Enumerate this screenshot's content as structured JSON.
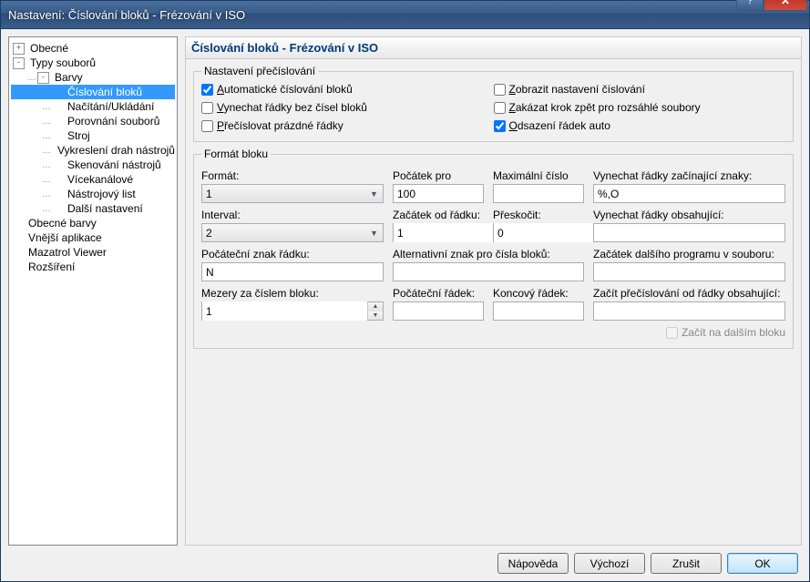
{
  "window": {
    "title": "Nastavení: Číslování bloků - Frézování v ISO"
  },
  "tree": {
    "items": [
      {
        "lvl": 0,
        "exp": "+",
        "label": "Obecné"
      },
      {
        "lvl": 0,
        "exp": "-",
        "label": "Typy souborů"
      },
      {
        "lvl": 1,
        "exp": "-",
        "label": "Barvy"
      },
      {
        "lvl": 2,
        "exp": "",
        "label": "Číslování bloků",
        "sel": true
      },
      {
        "lvl": 2,
        "exp": "",
        "label": "Načítání/Ukládání"
      },
      {
        "lvl": 2,
        "exp": "",
        "label": "Porovnání souborů"
      },
      {
        "lvl": 2,
        "exp": "",
        "label": "Stroj"
      },
      {
        "lvl": 2,
        "exp": "",
        "label": "Vykreslení drah nástrojů"
      },
      {
        "lvl": 2,
        "exp": "",
        "label": "Skenování nástrojů"
      },
      {
        "lvl": 2,
        "exp": "",
        "label": "Vícekanálové"
      },
      {
        "lvl": 2,
        "exp": "",
        "label": "Nástrojový list"
      },
      {
        "lvl": 2,
        "exp": "",
        "label": "Další nastavení"
      },
      {
        "lvl": 0,
        "exp": "",
        "label": "Obecné barvy"
      },
      {
        "lvl": 0,
        "exp": "",
        "label": "Vnější aplikace"
      },
      {
        "lvl": 0,
        "exp": "",
        "label": "Mazatrol Viewer"
      },
      {
        "lvl": 0,
        "exp": "",
        "label": "Rozšíření"
      }
    ]
  },
  "header": "Číslování bloků - Frézování v ISO",
  "group1": {
    "legend": "Nastavení přečíslování",
    "c1": {
      "checked": true,
      "pre": "A",
      "rest": "utomatické číslování bloků"
    },
    "c2": {
      "checked": false,
      "pre": "V",
      "rest": "ynechat řádky bez čísel bloků"
    },
    "c3": {
      "checked": false,
      "pre": "P",
      "rest": "řečíslovat prázdné řádky"
    },
    "c4": {
      "checked": false,
      "pre": "Z",
      "rest": "obrazit nastavení číslování"
    },
    "c5": {
      "checked": false,
      "pre": "Z",
      "rest": "akázat krok zpět pro rozsáhlé soubory"
    },
    "c6": {
      "checked": true,
      "pre": "O",
      "rest": "dsazení řádek auto"
    }
  },
  "group2": {
    "legend": "Formát bloku",
    "col1": {
      "l": "Formát:",
      "v": "1"
    },
    "col2": {
      "l": "Počátek pro",
      "v": "100"
    },
    "col3": {
      "l": "Maximální číslo",
      "v": ""
    },
    "col4": {
      "l": "Vynechat řádky začínající znaky:",
      "v": "%,O"
    },
    "r2c1": {
      "l": "Interval:",
      "v": "2"
    },
    "r2c2": {
      "l": "Začátek od řádku:",
      "v": "1"
    },
    "r2c3": {
      "l": "Přeskočit:",
      "v": "0"
    },
    "r2c4": {
      "l": "Vynechat řádky obsahující:",
      "v": ""
    },
    "r3c1": {
      "l": "Počáteční znak řádku:",
      "v": "N"
    },
    "r3c2": {
      "l": "Alternativní znak pro čísla bloků:",
      "v": ""
    },
    "r3c4": {
      "l": "Začátek dalšího programu v souboru:",
      "v": ""
    },
    "r4c1": {
      "l": "Mezery za číslem bloku:",
      "v": "1"
    },
    "r4c2": {
      "l": "Počáteční řádek:",
      "v": ""
    },
    "r4c3": {
      "l": "Koncový řádek:",
      "v": ""
    },
    "r4c4": {
      "l": "Začít přečíslování od řádky obsahující:",
      "v": ""
    },
    "startNext": "Začít na dalším bloku"
  },
  "buttons": {
    "help": "Nápověda",
    "def": "Výchozí",
    "cancel": "Zrušit",
    "ok": "OK"
  }
}
